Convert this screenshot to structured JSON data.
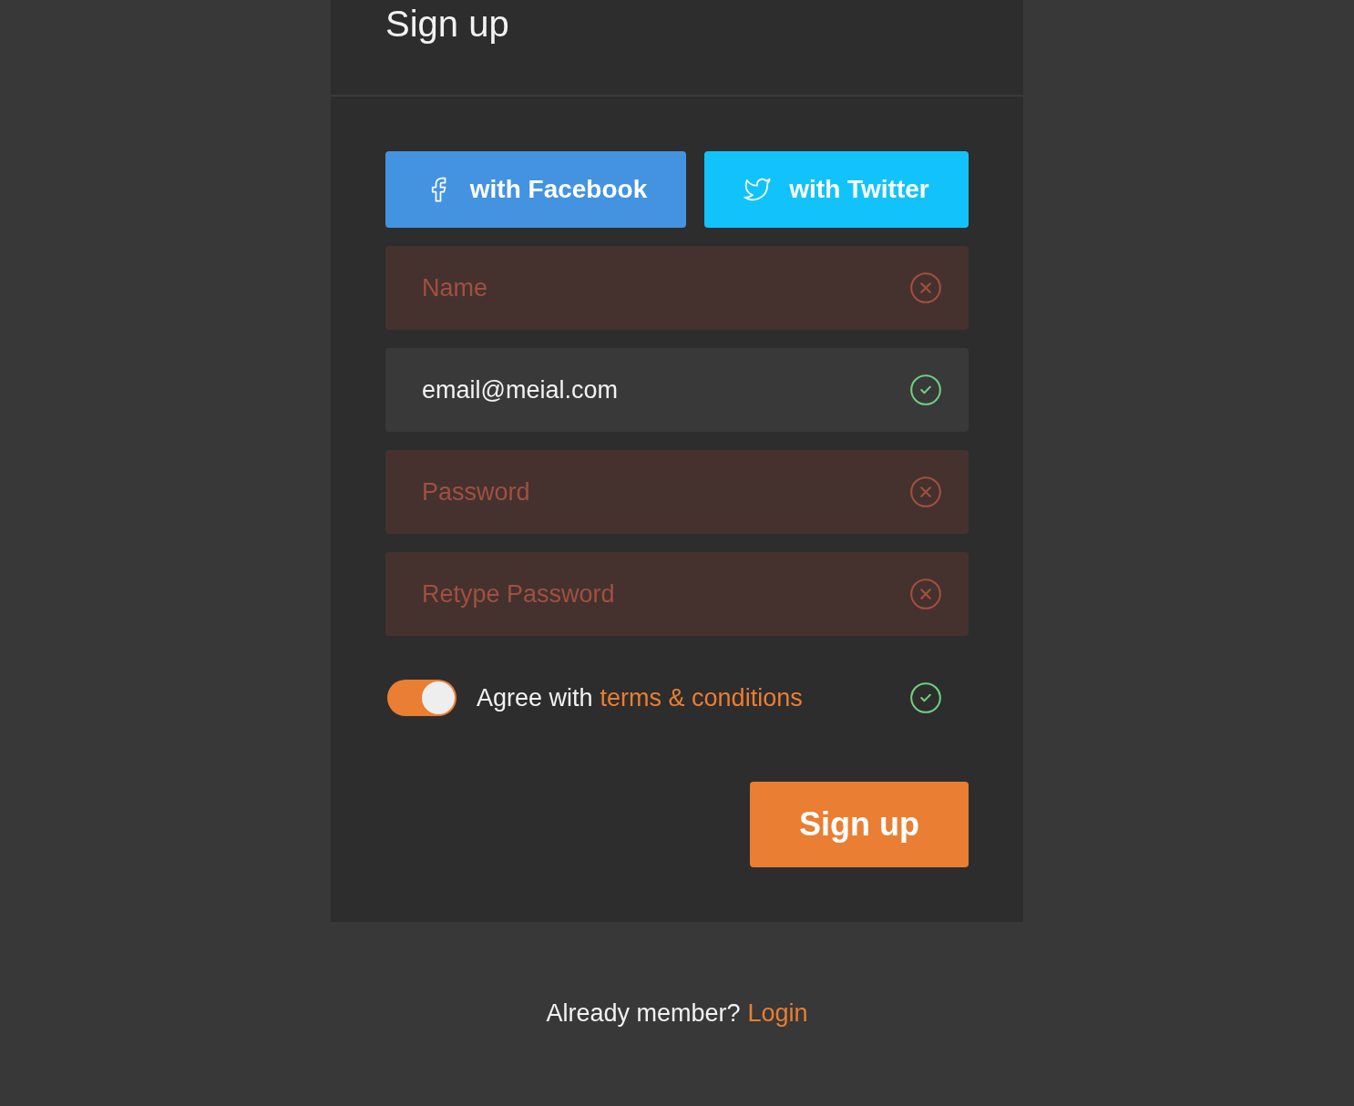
{
  "header": {
    "title": "Sign up"
  },
  "social_buttons": [
    {
      "kind": "facebook",
      "label": "with Facebook"
    },
    {
      "kind": "twitter",
      "label": "with Twitter"
    }
  ],
  "fields": [
    {
      "placeholder": "Name",
      "valid": false
    },
    {
      "value": "email@meial.com",
      "valid": true
    },
    {
      "placeholder": "Password",
      "valid": false
    },
    {
      "placeholder": "Retype Password",
      "valid": false
    }
  ],
  "agreement": {
    "on": true,
    "text": "Agree with",
    "link": "terms & conditions",
    "valid": true
  },
  "submit": {
    "label": "Sign up"
  },
  "footer": {
    "text": "Already member?",
    "link": "Login"
  }
}
